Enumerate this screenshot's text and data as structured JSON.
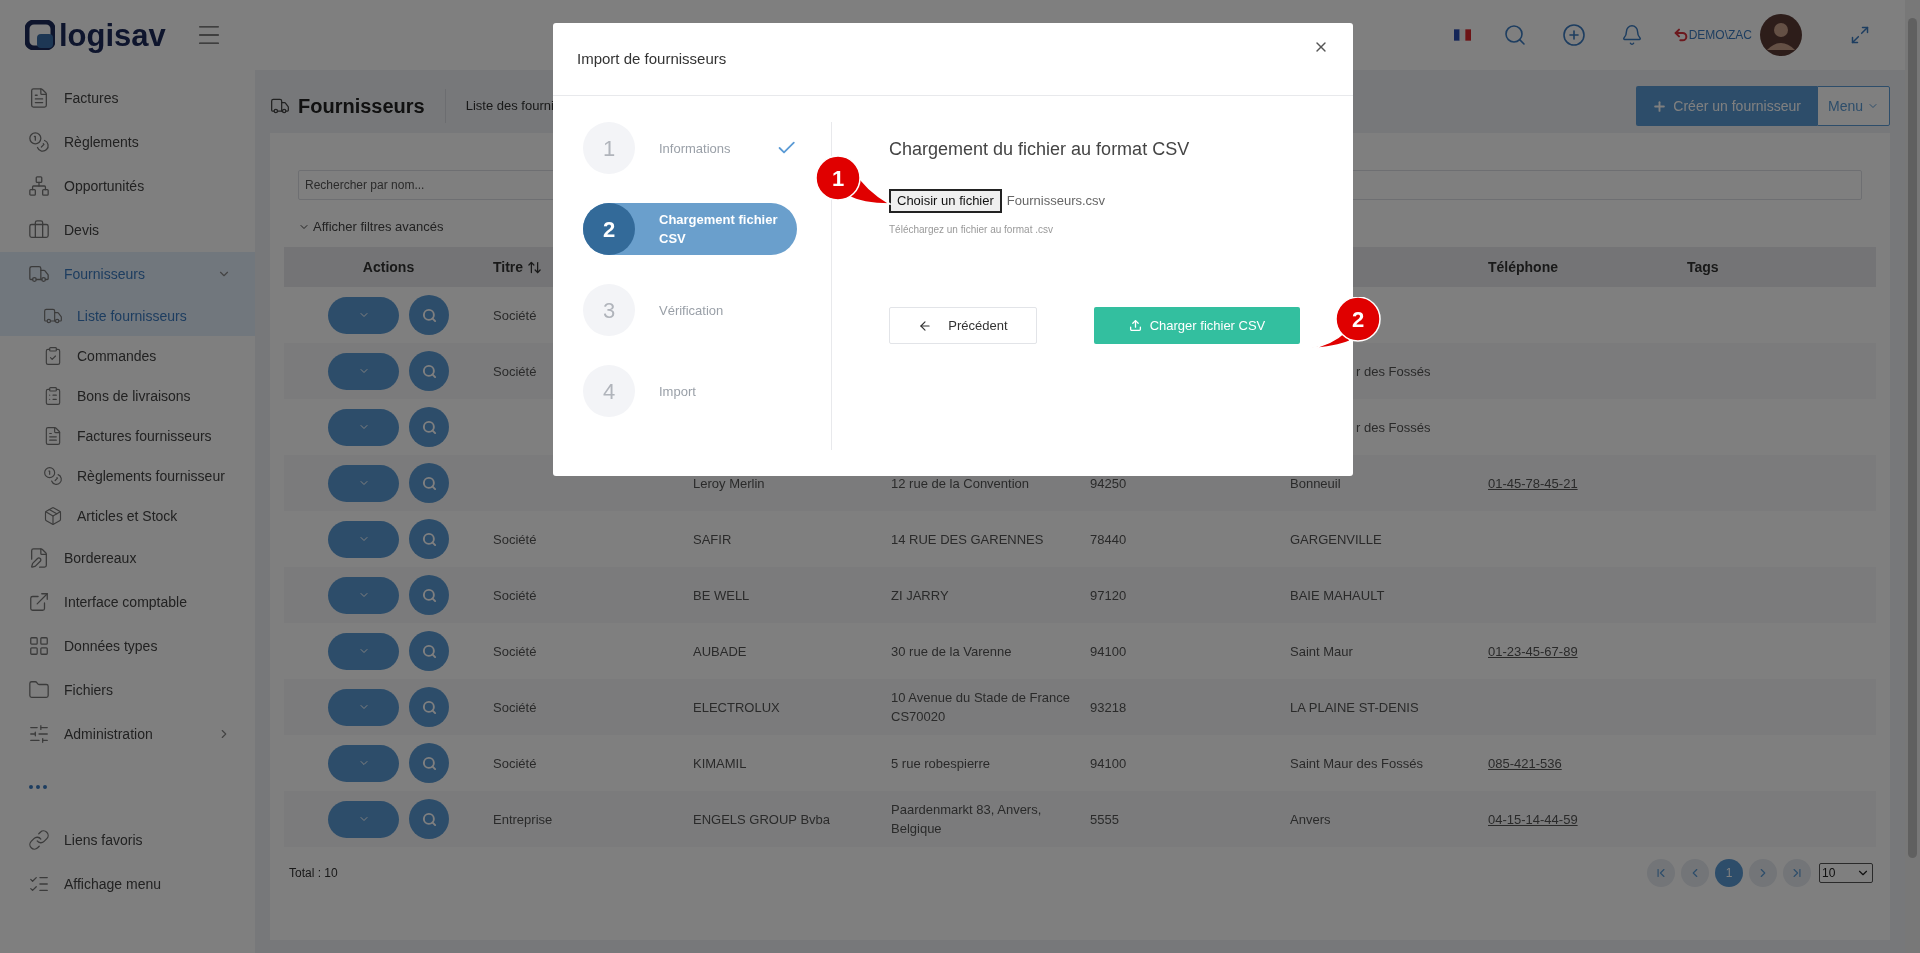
{
  "header": {
    "logo": "logisav",
    "user": "DEMO\\ZAC"
  },
  "sidebar": {
    "items": [
      {
        "label": "Factures",
        "kind": "link",
        "selected": false
      },
      {
        "label": "Règlements",
        "kind": "link",
        "selected": false
      },
      {
        "label": "Opportunités",
        "kind": "link",
        "selected": false
      },
      {
        "label": "Devis",
        "kind": "link",
        "selected": false
      },
      {
        "label": "Fournisseurs",
        "kind": "group",
        "selected": true,
        "expanded": true,
        "children": [
          {
            "label": "Liste fournisseurs",
            "selected": true
          },
          {
            "label": "Commandes",
            "selected": false
          },
          {
            "label": "Bons de livraisons",
            "selected": false
          },
          {
            "label": "Factures fournisseurs",
            "selected": false
          },
          {
            "label": "Règlements fournisseur",
            "selected": false
          },
          {
            "label": "Articles et Stock",
            "selected": false
          }
        ]
      },
      {
        "label": "Bordereaux",
        "kind": "link",
        "selected": false
      },
      {
        "label": "Interface comptable",
        "kind": "link",
        "selected": false
      },
      {
        "label": "Données types",
        "kind": "link",
        "selected": false
      },
      {
        "label": "Fichiers",
        "kind": "link",
        "selected": false
      },
      {
        "label": "Administration",
        "kind": "group",
        "selected": false,
        "expanded": false
      }
    ],
    "bottom": [
      {
        "label": "Liens favoris"
      },
      {
        "label": "Affichage menu"
      }
    ]
  },
  "page": {
    "title": "Fournisseurs",
    "breadcrumb": "Liste des fourni",
    "create_button": "Créer un fournisseur",
    "menu_button": "Menu"
  },
  "search": {
    "placeholder": "Rechercher par nom..."
  },
  "filters_toggle": "Afficher filtres avancés",
  "table": {
    "columns": [
      {
        "label": "Actions"
      },
      {
        "label": "Titre",
        "sortable": true
      },
      null,
      null,
      null,
      null,
      {
        "label": "Téléphone",
        "kind": "phone"
      },
      {
        "label": "Tags"
      }
    ],
    "rows": [
      {
        "cells": [
          "",
          "Société",
          "",
          "",
          "",
          "",
          "",
          ""
        ]
      },
      {
        "cells": [
          "",
          "Société",
          "",
          "",
          "",
          {
            "text": "r des Fossés",
            "cut": true
          },
          "",
          ""
        ]
      },
      {
        "cells": [
          "",
          "",
          "",
          "",
          "",
          {
            "text": "r des Fossés",
            "cut": true
          },
          "",
          ""
        ]
      },
      {
        "cells": [
          "",
          "",
          "Leroy Merlin",
          "12 rue de la Convention",
          "94250",
          "Bonneuil",
          "01-45-78-45-21",
          ""
        ]
      },
      {
        "cells": [
          "",
          "Société",
          "SAFIR",
          "14 RUE DES GARENNES",
          "78440",
          "GARGENVILLE",
          "",
          ""
        ]
      },
      {
        "cells": [
          "",
          "Société",
          "BE WELL",
          "ZI JARRY",
          "97120",
          "BAIE MAHAULT",
          "",
          ""
        ]
      },
      {
        "cells": [
          "",
          "Société",
          "AUBADE",
          "30 rue de la Varenne",
          "94100",
          "Saint Maur",
          "01-23-45-67-89",
          ""
        ]
      },
      {
        "cells": [
          "",
          "Société",
          "ELECTROLUX",
          "10 Avenue du Stade de France CS70020",
          "93218",
          "LA PLAINE ST-DENIS",
          "",
          ""
        ]
      },
      {
        "cells": [
          "",
          "Société",
          "KIMAMIL",
          "5 rue robespierre",
          "94100",
          "Saint Maur des Fossés",
          "085-421-536",
          ""
        ]
      },
      {
        "cells": [
          "",
          "Entreprise",
          "ENGELS GROUP Bvba",
          "Paardenmarkt 83, Anvers, Belgique",
          "5555",
          "Anvers",
          "04-15-14-44-59",
          ""
        ]
      }
    ]
  },
  "total": "Total : 10",
  "pagination": {
    "pages": [
      {
        "label": "1",
        "selected": true
      }
    ],
    "page_size": "10"
  },
  "modal": {
    "title": "Import de fournisseurs",
    "steps": [
      {
        "number": "1",
        "label": "Informations",
        "selected": false,
        "completed": true
      },
      {
        "number": "2",
        "label": "Chargement fichier CSV",
        "selected": true,
        "completed": false
      },
      {
        "number": "3",
        "label": "Vérification",
        "selected": false,
        "completed": false
      },
      {
        "number": "4",
        "label": "Import",
        "selected": false,
        "completed": false
      }
    ],
    "heading": "Chargement du fichier au format CSV",
    "file_button": "Choisir un fichier",
    "file_name": "Fournisseurs.csv",
    "hint": "Téléchargez un fichier au format .csv",
    "back_button": "Précédent",
    "upload_button": "Charger fichier CSV"
  },
  "annotations": [
    {
      "label": "1"
    },
    {
      "label": "2"
    }
  ]
}
